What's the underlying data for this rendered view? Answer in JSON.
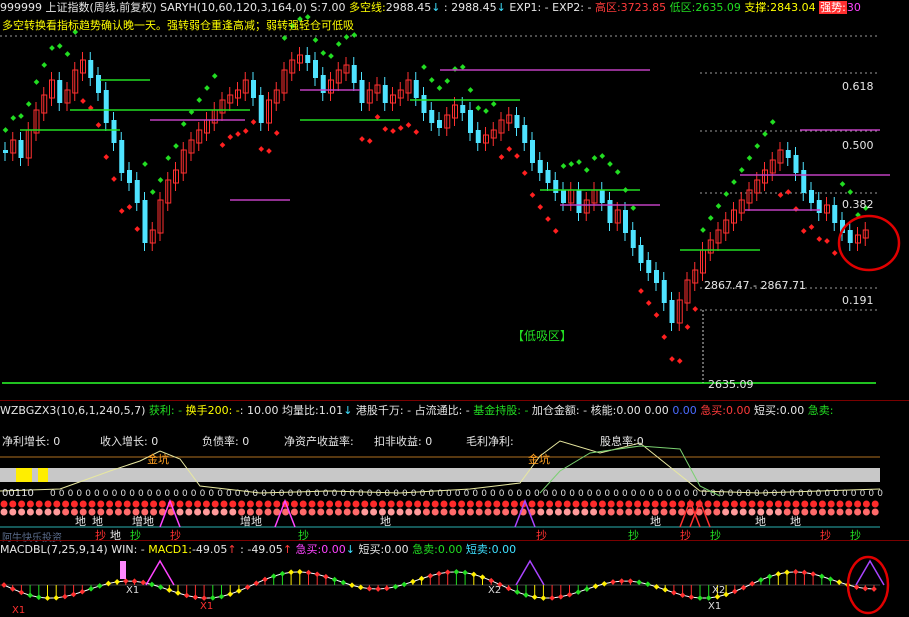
{
  "colors": {
    "up": "#ff3030",
    "down": "#4fe3ff",
    "sar_up": "#22dd22",
    "sar_down": "#ff2020",
    "support_line": "#20c020",
    "resist_line": "#c040c0",
    "ma_line": "#ff66ff",
    "fib_line": "#ffffff",
    "circle": "#e00000"
  },
  "header": {
    "symbol": "999999 上证指数(周线,前复权)",
    "indicator": "SARYH(10,60,120,3,164,0)",
    "s_label": "S:",
    "s_value": "7.00",
    "duo_label": "多空线:",
    "duo_value": "2988.45",
    "duo_arrow": "↓",
    "sep_colon": ":",
    "duo_value2": "2988.45",
    "duo_arrow2": "↓",
    "exp1": "EXP1: -",
    "exp2": "EXP2: -",
    "high_label": "高区:",
    "high_value": "3723.85",
    "low_label": "低区:",
    "low_value": "2635.09",
    "support_label": "支撑:",
    "support_value": "2843.04",
    "strong_label": "强势:",
    "strong_value": "30"
  },
  "notice": "多空转换看指标趋势确认晚一天。强转弱仓重逢高减；弱转强轻仓可低吸",
  "price_labels": {
    "fib_618": "0.618",
    "fib_500": "0.500",
    "fib_382": "0.382",
    "fib_191": "0.191",
    "range_label": "2867.47 - 2867.71",
    "low_point": "2635.09",
    "low_zone": "【低吸区】"
  },
  "panel2": {
    "name": "WZBGZX3(10,6,1,240,5,7)",
    "huoli": "获利: -",
    "huanshou": "换手200: -",
    "huanshou_val": ": 10.00",
    "liangbi": "均量比:",
    "liangbi_val": "1.01",
    "liangbi_arrow": "↓",
    "ganggu": "港股千万: -",
    "zhanliutong": "占流通比: -",
    "jijin": "基金持股: -",
    "jiacang": "加仓金额: -",
    "hexin": "核能:",
    "v1": "0.00",
    "v2": "0.00",
    "v3": "0.00",
    "jimai": "急买:",
    "jimai_val": "0.00",
    "duanmai": "短买:",
    "duanmai_val": "0.00",
    "jimai2": "急卖:"
  },
  "fundamentals": [
    {
      "label": "净利增长:",
      "value": "0"
    },
    {
      "label": "收入增长:",
      "value": "0"
    },
    {
      "label": "负债率:",
      "value": "0"
    },
    {
      "label": "净资产收益率:",
      "value": ""
    },
    {
      "label": "扣非收益:",
      "value": "0"
    },
    {
      "label": "毛利净利:",
      "value": ""
    },
    {
      "label": "股息率:",
      "value": "0"
    }
  ],
  "gold_pit": [
    "金坑",
    "金坑"
  ],
  "zero_row_prefix": "00110",
  "di_labels": [
    "地",
    "地",
    "增地",
    "增地",
    "地",
    "地",
    "地",
    "地",
    "地"
  ],
  "chao_labels": [
    "抄",
    "抄",
    "抄",
    "抄",
    "抄",
    "抄",
    "抄",
    "抄",
    "抄",
    "抄"
  ],
  "watermark": "阿牛快乐投资",
  "panel3": {
    "name": "MACDBL(7,25,9,14)",
    "win_label": "WIN: -",
    "macd_label": "MACD1:",
    "macd_val": "-49.05",
    "macd_arrow": "↑",
    "sep_colon": ":",
    "macd_val2": "-49.05",
    "macd_arrow2": "↑",
    "jimai": "急买:",
    "jimai_val": "0.00",
    "jimai_arrow": "↓",
    "duanmai": "短买:",
    "duanmai_val": "0.00",
    "jimai2": "急卖:",
    "jimai2_val": "0.00",
    "duanmai2": "短卖:",
    "duanmai2_val": "0.00",
    "x_labels": [
      "X1",
      "X1",
      "X1",
      "X2",
      "X1",
      "X2"
    ]
  }
}
